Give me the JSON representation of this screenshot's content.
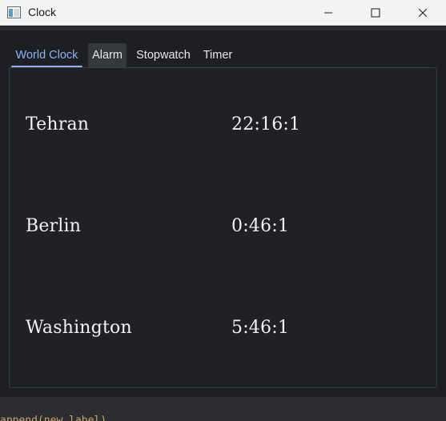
{
  "window": {
    "title": "Clock",
    "icons": {
      "app": "app-window-icon",
      "minimize": "minimize-icon",
      "maximize": "maximize-icon",
      "close": "close-icon"
    }
  },
  "tabs": [
    {
      "label": "World Clock",
      "selected": true
    },
    {
      "label": "Alarm",
      "selected": false
    },
    {
      "label": "Stopwatch",
      "selected": false
    },
    {
      "label": "Timer",
      "selected": false
    }
  ],
  "world_clock": {
    "rows": [
      {
        "city": "Tehran",
        "time": "22:16:1"
      },
      {
        "city": "Berlin",
        "time": "0:46:1"
      },
      {
        "city": "Washington",
        "time": "5:46:1"
      }
    ]
  },
  "background_text": "append(new_label)",
  "colors": {
    "accent": "#8ab4f8",
    "background": "#1c1e21",
    "titlebar": "#f3f3f3"
  }
}
